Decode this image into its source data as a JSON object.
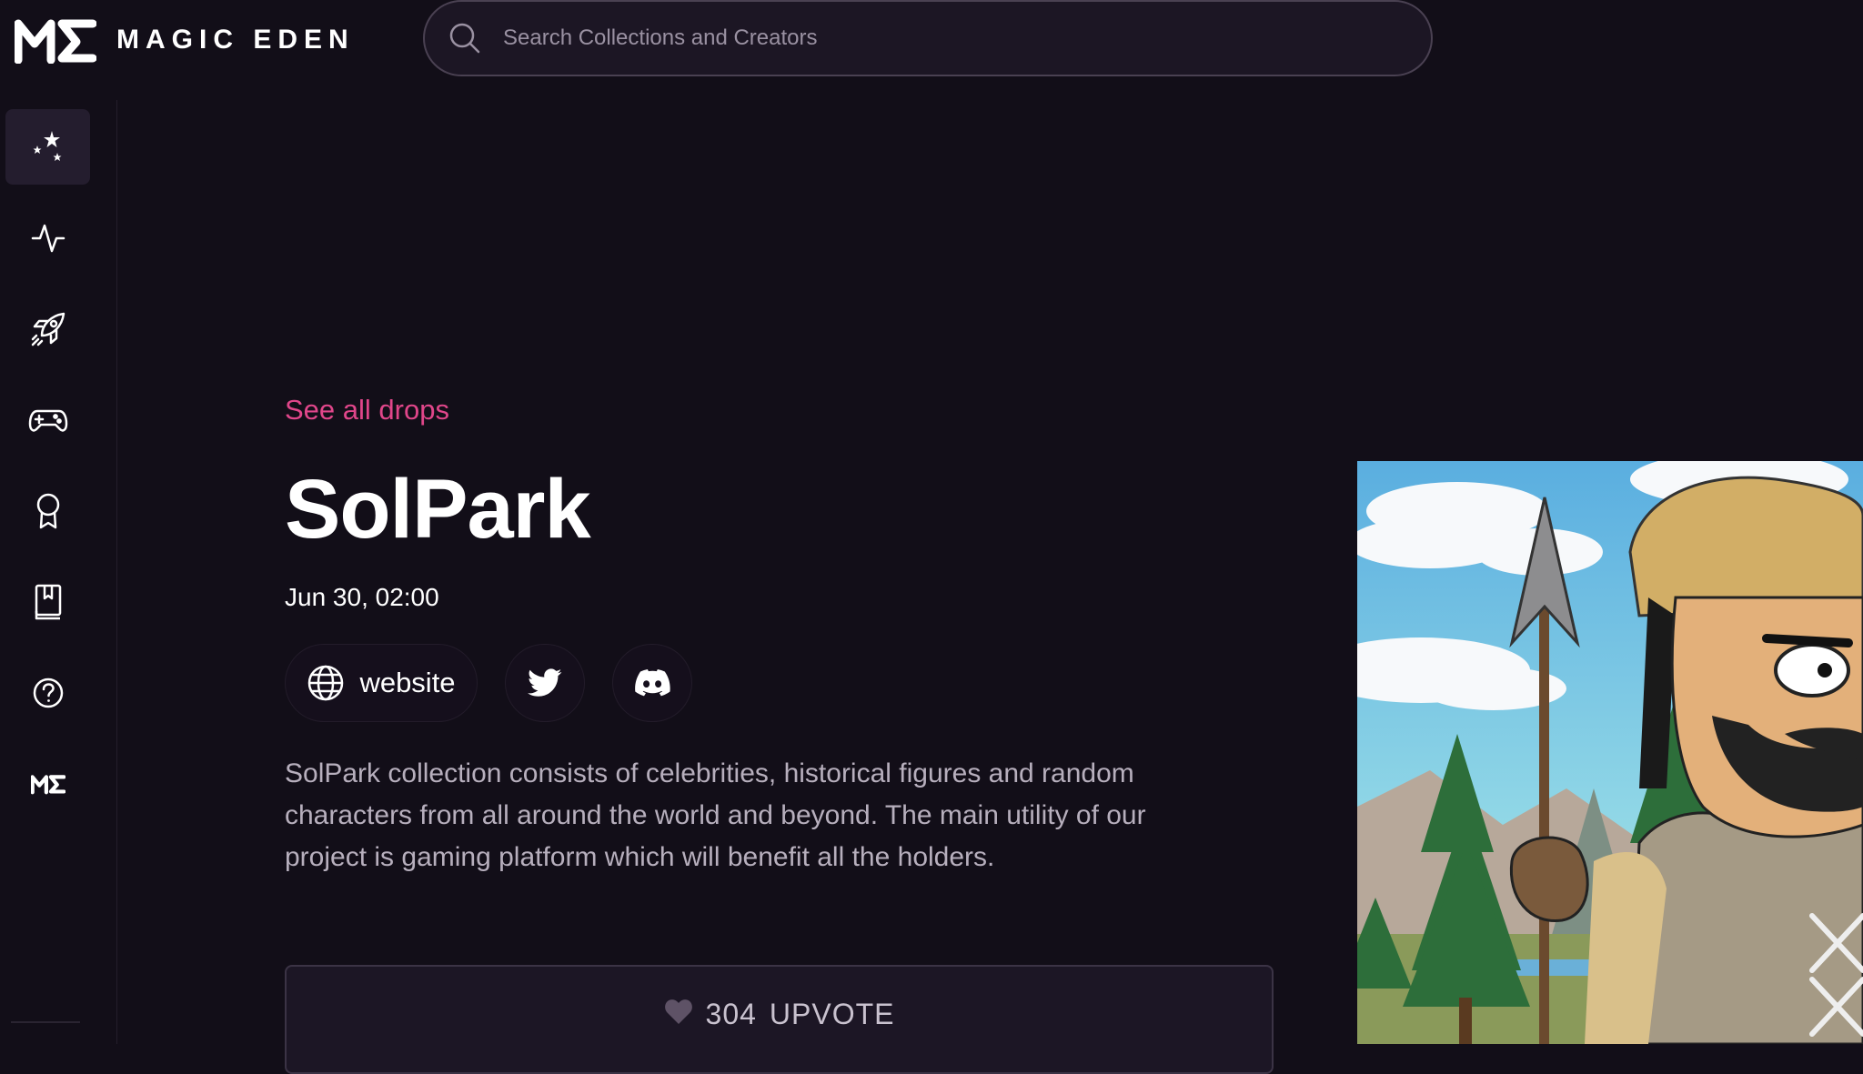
{
  "header": {
    "logo_text": "MAGIC EDEN",
    "search_placeholder": "Search Collections and Creators"
  },
  "sidebar": {
    "items": [
      {
        "icon": "sparkles-icon",
        "active": true
      },
      {
        "icon": "activity-icon"
      },
      {
        "icon": "rocket-icon"
      },
      {
        "icon": "gamepad-icon"
      },
      {
        "icon": "award-icon"
      },
      {
        "icon": "book-icon"
      },
      {
        "icon": "help-icon"
      },
      {
        "icon": "me-logo-icon"
      }
    ]
  },
  "drop": {
    "see_all_label": "See all drops",
    "title": "SolPark",
    "date": "Jun 30, 02:00",
    "website_label": "website",
    "description": "SolPark collection consists of celebrities, historical figures and random characters from all around the world and beyond. The main utility of our project is gaming platform which will benefit all the holders.",
    "upvote_count": "304",
    "upvote_label": "UPVOTE"
  },
  "colors": {
    "background": "#120e18",
    "accent_pink": "#e0468a",
    "text_muted": "#b7afbd"
  }
}
